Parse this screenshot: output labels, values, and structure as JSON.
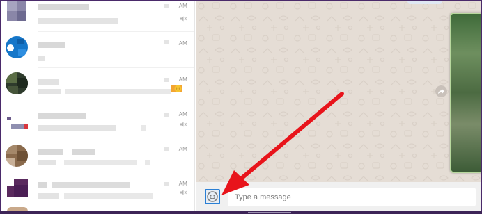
{
  "chat_list": {
    "items": [
      {
        "time": "AM",
        "muted": true
      },
      {
        "time": "AM",
        "muted": false
      },
      {
        "time": "AM",
        "muted": false,
        "has_emoji": true
      },
      {
        "time": "AM",
        "muted": true
      },
      {
        "time": "AM",
        "muted": false
      },
      {
        "time": "AM",
        "muted": true
      }
    ]
  },
  "composer": {
    "placeholder": "Type a message",
    "emoji_icon": "smiley-icon"
  },
  "colors": {
    "annotation_arrow": "#e8141b",
    "emoji_highlight": "#2a7fd4",
    "chat_background": "#e5ddd5"
  }
}
